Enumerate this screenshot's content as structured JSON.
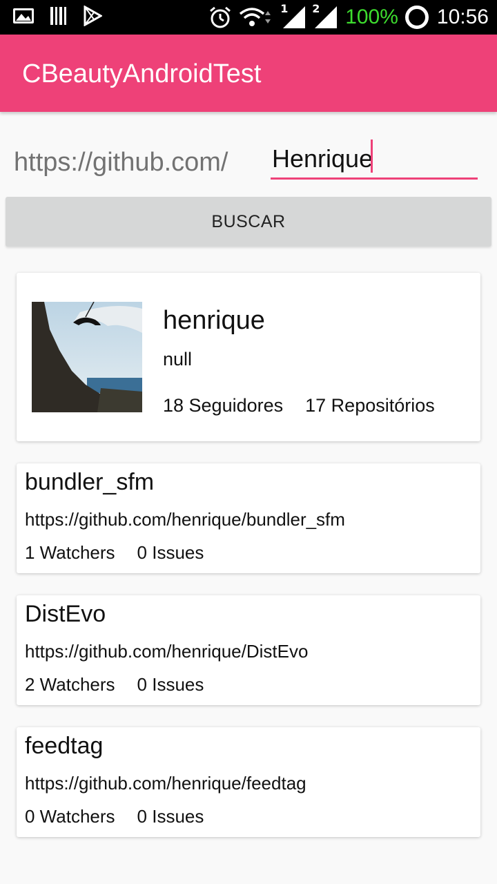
{
  "status_bar": {
    "battery": "100%",
    "time": "10:56",
    "sim1": "1",
    "sim2": "2",
    "icons": [
      "image-icon",
      "barcode-icon",
      "play-store-icon",
      "alarm-icon",
      "wifi-icon",
      "signal-icon",
      "signal-icon",
      "battery-icon"
    ]
  },
  "app_bar": {
    "title": "CBeautyAndroidTest"
  },
  "search": {
    "prefix": "https://github.com/",
    "value": "Henrique",
    "button_label": "BUSCAR"
  },
  "colors": {
    "accent": "#ee4178",
    "battery": "#3ddc2e"
  },
  "user": {
    "login": "henrique",
    "bio": "null",
    "followers": "18 Seguidores",
    "repos": "17 Repositórios"
  },
  "repositories": [
    {
      "name": "bundler_sfm",
      "url": "https://github.com/henrique/bundler_sfm",
      "watchers": "1 Watchers",
      "issues": "0 Issues"
    },
    {
      "name": "DistEvo",
      "url": "https://github.com/henrique/DistEvo",
      "watchers": "2 Watchers",
      "issues": "0 Issues"
    },
    {
      "name": "feedtag",
      "url": "https://github.com/henrique/feedtag",
      "watchers": "0 Watchers",
      "issues": "0 Issues"
    }
  ]
}
